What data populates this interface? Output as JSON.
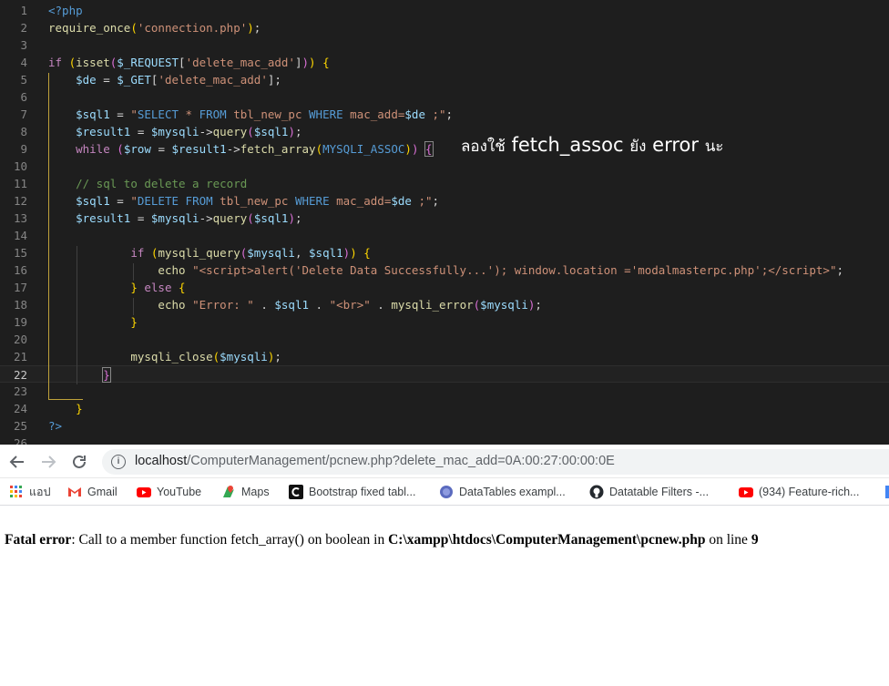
{
  "editor": {
    "lines": [
      {
        "num": "1",
        "html": "<span class=\"kw\">&lt;?php</span>"
      },
      {
        "num": "2",
        "html": "<span class=\"fn\">require_once</span><span class=\"brk\">(</span><span class=\"str\">'connection.php'</span><span class=\"brk\">)</span>;"
      },
      {
        "num": "3",
        "html": ""
      },
      {
        "num": "4",
        "html": "<span class=\"ctl\">if</span> <span class=\"brk\">(</span><span class=\"fn\">isset</span><span class=\"brk2\">(</span><span class=\"var\">$_REQUEST</span>[<span class=\"str\">'delete_mac_add'</span>]<span class=\"brk2\">)</span><span class=\"brk\">)</span> <span class=\"brk\">{</span>"
      },
      {
        "num": "5",
        "html": "    <span class=\"var\">$de</span> = <span class=\"var\">$_GET</span>[<span class=\"str\">'delete_mac_add'</span>];"
      },
      {
        "num": "6",
        "html": ""
      },
      {
        "num": "7",
        "html": "    <span class=\"var\">$sql1</span> = <span class=\"str\">\"</span><span class=\"kw\">SELECT</span><span class=\"str\"> * </span><span class=\"kw\">FROM</span><span class=\"str\"> tbl_new_pc </span><span class=\"kw\">WHERE</span><span class=\"str\"> mac_add=</span><span class=\"var\">$de</span><span class=\"str\"> ;\"</span>;"
      },
      {
        "num": "8",
        "html": "    <span class=\"var\">$result1</span> = <span class=\"var\">$mysqli</span>-&gt;<span class=\"fn\">query</span><span class=\"brk2\">(</span><span class=\"var\">$sql1</span><span class=\"brk2\">)</span>;"
      },
      {
        "num": "9",
        "html": "    <span class=\"ctl\">while</span> <span class=\"brk2\">(</span><span class=\"var\">$row</span> = <span class=\"var\">$result1</span>-&gt;<span class=\"fn\">fetch_array</span><span class=\"brk\">(</span><span class=\"kw\">MYSQLI_ASSOC</span><span class=\"brk\">)</span><span class=\"brk2\">)</span> <span class=\"brk2\" style=\"outline:1px solid #888;\">{</span>"
      },
      {
        "num": "10",
        "html": ""
      },
      {
        "num": "11",
        "html": "    <span class=\"cmt\">// sql to delete a record</span>"
      },
      {
        "num": "12",
        "html": "    <span class=\"var\">$sql1</span> = <span class=\"str\">\"</span><span class=\"kw\">DELETE FROM</span><span class=\"str\"> tbl_new_pc </span><span class=\"kw\">WHERE</span><span class=\"str\"> mac_add=</span><span class=\"var\">$de</span><span class=\"str\"> ;\"</span>;"
      },
      {
        "num": "13",
        "html": "    <span class=\"var\">$result1</span> = <span class=\"var\">$mysqli</span>-&gt;<span class=\"fn\">query</span><span class=\"brk2\">(</span><span class=\"var\">$sql1</span><span class=\"brk2\">)</span>;"
      },
      {
        "num": "14",
        "html": ""
      },
      {
        "num": "15",
        "html": "            <span class=\"ctl\">if</span> <span class=\"brk\">(</span><span class=\"fn\">mysqli_query</span><span class=\"brk2\">(</span><span class=\"var\">$mysqli</span>, <span class=\"var\">$sql1</span><span class=\"brk2\">)</span><span class=\"brk\">)</span> <span class=\"brk\">{</span>"
      },
      {
        "num": "16",
        "html": "                <span class=\"fn\">echo</span> <span class=\"str\">\"&lt;script&gt;alert('Delete Data Successfully...'); window.location ='modalmasterpc.php';&lt;/script&gt;\"</span>;"
      },
      {
        "num": "17",
        "html": "            <span class=\"brk\">}</span> <span class=\"ctl\">else</span> <span class=\"brk\">{</span>"
      },
      {
        "num": "18",
        "html": "                <span class=\"fn\">echo</span> <span class=\"str\">\"Error: \"</span> . <span class=\"var\">$sql1</span> . <span class=\"str\">\"&lt;br&gt;\"</span> . <span class=\"fn\">mysqli_error</span><span class=\"brk2\">(</span><span class=\"var\">$mysqli</span><span class=\"brk2\">)</span>;"
      },
      {
        "num": "19",
        "html": "            <span class=\"brk\">}</span>"
      },
      {
        "num": "20",
        "html": ""
      },
      {
        "num": "21",
        "html": "            <span class=\"fn\">mysqli_close</span><span class=\"brk\">(</span><span class=\"var\">$mysqli</span><span class=\"brk\">)</span>;"
      },
      {
        "num": "22",
        "html": "        <span class=\"brk2\" style=\"outline:1px solid #888;\">}</span>"
      },
      {
        "num": "23",
        "html": ""
      },
      {
        "num": "24",
        "html": "    <span class=\"brk\">}</span>"
      },
      {
        "num": "25",
        "html": "<span class=\"kw\">?&gt;</span>"
      },
      {
        "num": "26",
        "html": ""
      }
    ],
    "annotation_thai_1": "ลองใช้",
    "annotation_code": "fetch_assoc",
    "annotation_thai_2": "ยัง",
    "annotation_error": "error",
    "annotation_thai_3": "นะ"
  },
  "browser": {
    "url_host": "localhost",
    "url_path": "/ComputerManagement/pcnew.php?delete_mac_add=0A:00:27:00:00:0E",
    "bookmarks": [
      {
        "label": "แอป",
        "icon": "apps-grid-icon"
      },
      {
        "label": "Gmail",
        "icon": "gmail-icon"
      },
      {
        "label": "YouTube",
        "icon": "youtube-icon"
      },
      {
        "label": "Maps",
        "icon": "maps-icon"
      },
      {
        "label": "Bootstrap fixed tabl...",
        "icon": "codepen-icon"
      },
      {
        "label": "DataTables exampl...",
        "icon": "datatables-icon"
      },
      {
        "label": "Datatable Filters -...",
        "icon": "github-icon"
      },
      {
        "label": "(934) Feature-rich...",
        "icon": "youtube-icon"
      }
    ]
  },
  "page": {
    "error_label": "Fatal error",
    "error_text": ": Call to a member function fetch_array() on boolean in ",
    "error_path": "C:\\xampp\\htdocs\\ComputerManagement\\pcnew.php",
    "error_online": " on line ",
    "error_line": "9"
  },
  "colors": {
    "editor_bg": "#1e1e1e",
    "keyword": "#569cd6",
    "string": "#ce9178",
    "variable": "#9cdcfe",
    "function": "#dcdcaa"
  }
}
